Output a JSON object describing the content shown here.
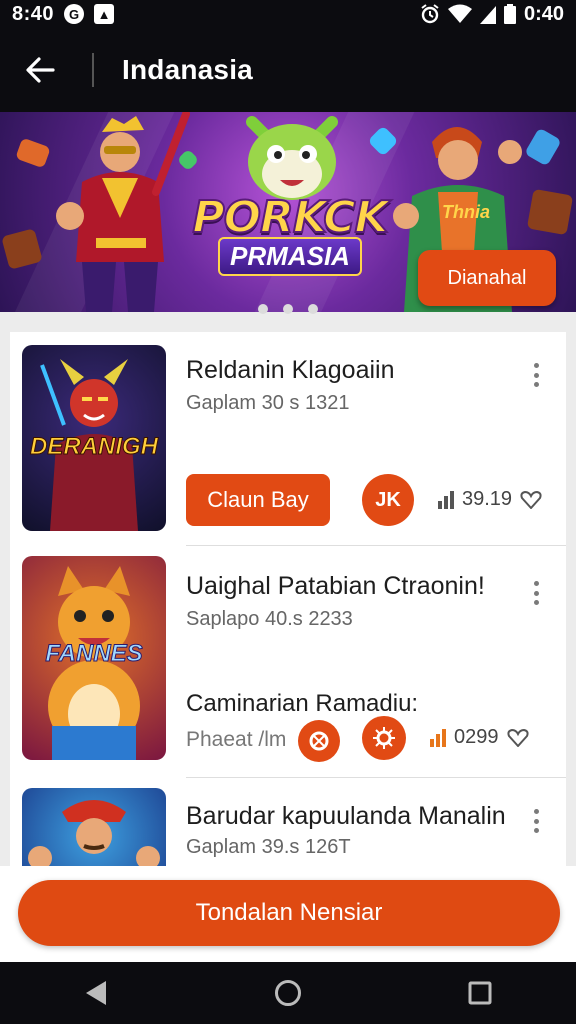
{
  "status_bar": {
    "time": "8:40",
    "clock": "0:40",
    "icons": [
      "notification-circle-icon",
      "app-square-icon",
      "alarm-icon",
      "wifi-icon",
      "signal-icon",
      "battery-icon"
    ]
  },
  "app_bar": {
    "title": "Indanasia"
  },
  "banner": {
    "logo_line1": "PORKCK",
    "logo_line2": "PRMASIA",
    "button_label": "Dianahal",
    "side_text": "Thnia",
    "dots": 3
  },
  "games": [
    {
      "thumb_label": "DERANIGH",
      "title": "Reldanin Klagoaiin",
      "subtitle": "Gaplam 30 s 1321",
      "claim_label": "Claun Bay",
      "round_label": "JK",
      "stat_value": "39.19"
    },
    {
      "thumb_label": "FANNES",
      "title": "Uaighal Patabian Ctraonin!",
      "subtitle": "Saplapo 40.s 2233",
      "line3": "Caminarian Ramadiu:",
      "line4": "Phaeat /lm",
      "stat_value": "0299"
    },
    {
      "thumb_label": "",
      "title": "Barudar kapuulanda Manalin",
      "subtitle": "Gaplam 39.s 126T"
    }
  ],
  "cta": {
    "label": "Tondalan Nensiar"
  },
  "colors": {
    "accent": "#e14a14",
    "bar_bg": "#0c0c10",
    "list_bg": "#ffffff",
    "page_bg": "#ececec"
  }
}
